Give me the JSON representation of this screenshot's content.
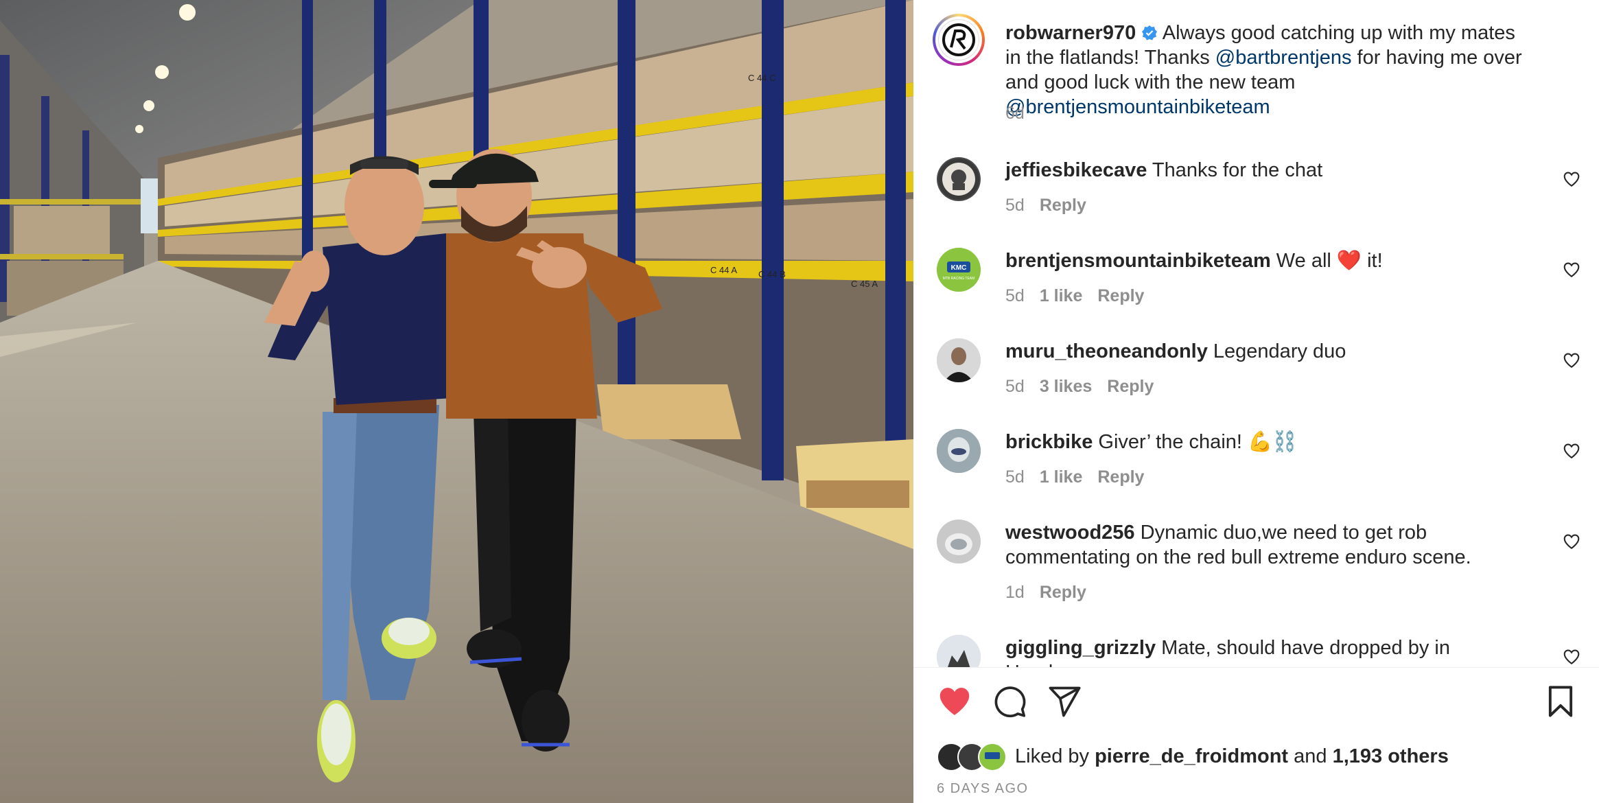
{
  "post": {
    "author": "robwarner970",
    "caption_part1": " Always good catching up with my mates in the flatlands! Thanks ",
    "mention1": "@bartbrentjens",
    "caption_part2": " for having me over and good luck with the new team ",
    "mention2": "@brentjensmountainbiketeam",
    "time": "6d"
  },
  "comments": [
    {
      "username": "jeffiesbikecave",
      "text": " Thanks for the chat",
      "time": "5d",
      "likes": "",
      "reply": "Reply"
    },
    {
      "username": "brentjensmountainbiketeam",
      "text": " We all ❤️ it!",
      "time": "5d",
      "likes": "1 like",
      "reply": "Reply",
      "avatar_text": "KMC",
      "avatar_subtext": "MTB RACING TEAM"
    },
    {
      "username": "muru_theoneandonly",
      "text": " Legendary duo",
      "time": "5d",
      "likes": "3 likes",
      "reply": "Reply"
    },
    {
      "username": "brickbike",
      "text": " Giver’ the chain! 💪⛓️",
      "time": "5d",
      "likes": "1 like",
      "reply": "Reply"
    },
    {
      "username": "westwood256",
      "text": " Dynamic duo,we need to get rob commentating on the red bull extreme enduro scene.",
      "time": "1d",
      "likes": "",
      "reply": "Reply"
    },
    {
      "username": "giggling_grizzly",
      "text": " Mate, should have dropped by in Haarlem.",
      "time": "",
      "likes": "",
      "reply": ""
    }
  ],
  "likes_line": {
    "prefix": "Liked by ",
    "user": "pierre_de_froidmont",
    "middle": " and ",
    "count": "1,193 others"
  },
  "post_date": "6 DAYS AGO",
  "photo": {
    "rack_labels": [
      "C 44 C",
      "C 44 A",
      "C 44 B",
      "C 45 A"
    ]
  },
  "icons": {
    "like": "heart-filled-icon",
    "comment": "comment-icon",
    "share": "share-icon",
    "save": "bookmark-icon",
    "verified": "verified-badge-icon",
    "comment_like": "heart-outline-icon"
  },
  "colors": {
    "like_red": "#ed4956",
    "mention": "#00376b",
    "muted": "#8e8e8e",
    "verified": "#3797f0"
  }
}
